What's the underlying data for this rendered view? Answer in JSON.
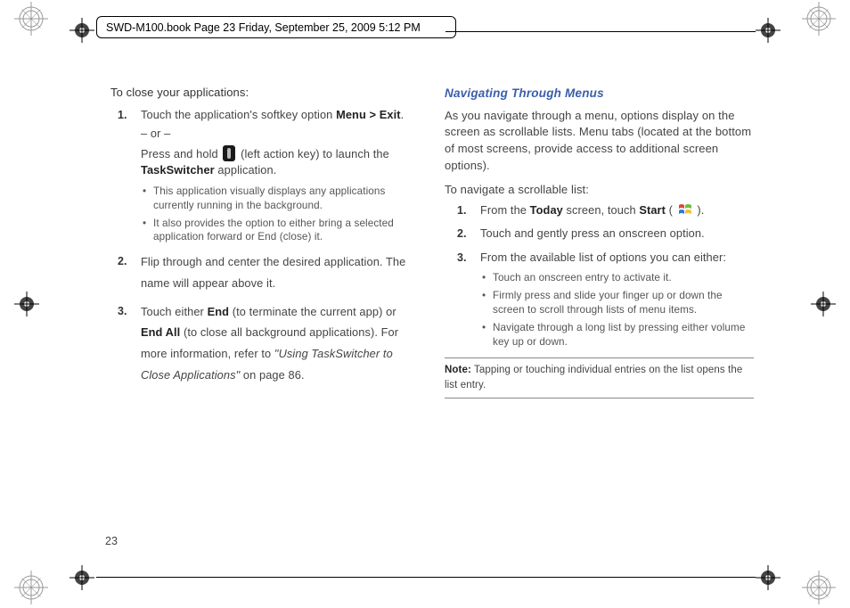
{
  "header": {
    "running_header": "SWD-M100.book  Page 23  Friday, September 25, 2009  5:12 PM"
  },
  "page_number": "23",
  "left_column": {
    "intro": "To close your applications:",
    "step1": {
      "num": "1.",
      "line_a_pre": "Touch the application's softkey option ",
      "line_a_bold": "Menu > Exit",
      "line_a_post": ".",
      "or": "– or –",
      "line_b_pre": "Press and hold ",
      "line_b_post": " (left action key) to launch the ",
      "line_b_bold": "TaskSwitcher",
      "line_b_end": " application.",
      "bullets": [
        "This application visually displays any applications currently running in the background.",
        "It also provides the option to either bring a selected application forward or End (close) it."
      ]
    },
    "step2": {
      "num": "2.",
      "text": "Flip through and center the desired application. The name will appear above it."
    },
    "step3": {
      "num": "3.",
      "pre": "Touch either ",
      "bold1": "End",
      "mid1": " (to terminate the current app) or ",
      "bold2": "End All",
      "mid2": " (to close all background applications). For more information, refer to ",
      "italic": "\"Using TaskSwitcher to Close Applications\"",
      "post": "  on page 86."
    }
  },
  "right_column": {
    "section_title": "Navigating Through Menus",
    "para1": "As you navigate through a menu, options display on the screen as scrollable lists. Menu tabs (located at the bottom of most screens, provide access to additional screen options).",
    "para2": "To navigate a scrollable list:",
    "step1": {
      "num": "1.",
      "pre": "From the ",
      "bold1": "Today",
      "mid": " screen, touch ",
      "bold2": "Start",
      "post_open": " ( ",
      "post_close": " )."
    },
    "step2": {
      "num": "2.",
      "text": "Touch and gently press an onscreen option."
    },
    "step3": {
      "num": "3.",
      "text": "From the available list of options you can either:",
      "bullets": [
        "Touch an onscreen entry to activate it.",
        "Firmly press and slide your finger up or down the screen to scroll through lists of menu items.",
        "Navigate through a long list by pressing either volume key up or down."
      ]
    },
    "note_label": "Note:",
    "note_text": " Tapping or touching individual entries on the list opens the list entry."
  }
}
